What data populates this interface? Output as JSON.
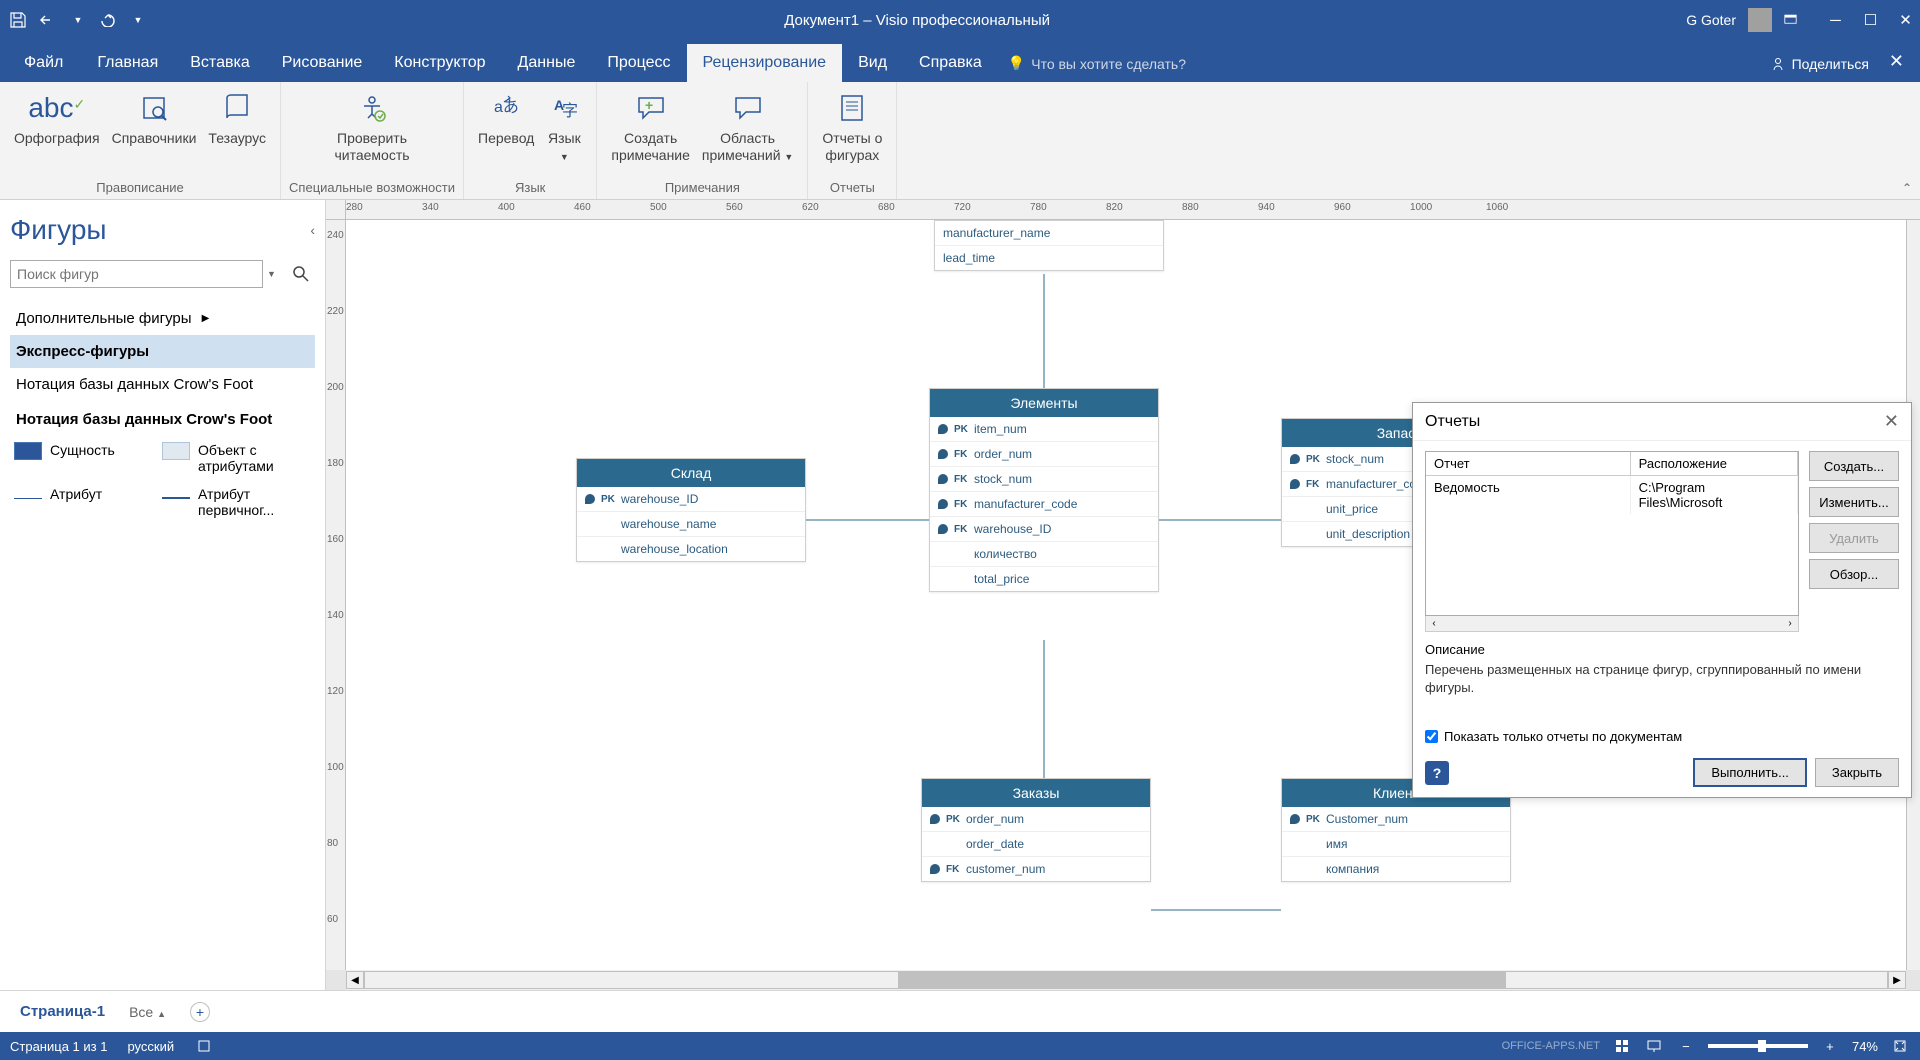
{
  "titlebar": {
    "title": "Документ1  –  Visio профессиональный",
    "user": "G Goter"
  },
  "tabs": {
    "file": "Файл",
    "items": [
      "Главная",
      "Вставка",
      "Рисование",
      "Конструктор",
      "Данные",
      "Процесс",
      "Рецензирование",
      "Вид",
      "Справка"
    ],
    "active_index": 6,
    "tellme": "Что вы хотите сделать?",
    "share": "Поделиться"
  },
  "ribbon": {
    "groups": [
      {
        "title": "Правописание",
        "buttons": [
          {
            "label": "Орфография"
          },
          {
            "label": "Справочники"
          },
          {
            "label": "Тезаурус"
          }
        ]
      },
      {
        "title": "Специальные возможности",
        "buttons": [
          {
            "label": "Проверить\nчитаемость"
          }
        ]
      },
      {
        "title": "Язык",
        "buttons": [
          {
            "label": "Перевод"
          },
          {
            "label": "Язык"
          }
        ]
      },
      {
        "title": "Примечания",
        "buttons": [
          {
            "label": "Создать\nпримечание"
          },
          {
            "label": "Область\nпримечаний"
          }
        ]
      },
      {
        "title": "Отчеты",
        "buttons": [
          {
            "label": "Отчеты о\nфигурах"
          }
        ]
      }
    ]
  },
  "shapes": {
    "title": "Фигуры",
    "search_placeholder": "Поиск фигур",
    "more": "Дополнительные фигуры",
    "items": [
      "Экспресс-фигуры",
      "Нотация базы данных Crow's Foot"
    ],
    "active_item": 0,
    "section_title": "Нотация базы данных Crow's Foot",
    "stencil": [
      {
        "name": "Сущность"
      },
      {
        "name": "Объект с атрибутами"
      },
      {
        "name": "Атрибут"
      },
      {
        "name": "Атрибут первичног..."
      }
    ]
  },
  "ruler_h": [
    280,
    340,
    400,
    460,
    500,
    560,
    620,
    680,
    720,
    780,
    820,
    880,
    940,
    960,
    1000,
    1060
  ],
  "ruler_v": [
    240,
    220,
    200,
    180,
    160,
    140,
    120,
    100,
    80,
    60
  ],
  "entities": {
    "partial_top": {
      "rows": [
        "manufacturer_name",
        "lead_time"
      ]
    },
    "warehouse": {
      "title": "Склад",
      "rows": [
        {
          "key": "PK",
          "name": "warehouse_ID"
        },
        {
          "key": "",
          "name": "warehouse_name"
        },
        {
          "key": "",
          "name": "warehouse_location"
        }
      ]
    },
    "elements": {
      "title": "Элементы",
      "rows": [
        {
          "key": "PK",
          "name": "item_num"
        },
        {
          "key": "FK",
          "name": "order_num"
        },
        {
          "key": "FK",
          "name": "stock_num"
        },
        {
          "key": "FK",
          "name": "manufacturer_code"
        },
        {
          "key": "FK",
          "name": "warehouse_ID"
        },
        {
          "key": "",
          "name": "количество"
        },
        {
          "key": "",
          "name": "total_price"
        }
      ]
    },
    "stock": {
      "title": "Запас",
      "rows": [
        {
          "key": "PK",
          "name": "stock_num"
        },
        {
          "key": "FK",
          "name": "manufacturer_code"
        },
        {
          "key": "",
          "name": "unit_price"
        },
        {
          "key": "",
          "name": "unit_description"
        }
      ]
    },
    "orders": {
      "title": "Заказы",
      "rows": [
        {
          "key": "PK",
          "name": "order_num"
        },
        {
          "key": "",
          "name": "order_date"
        },
        {
          "key": "FK",
          "name": "customer_num"
        }
      ]
    },
    "client": {
      "title": "Клиент",
      "rows": [
        {
          "key": "PK",
          "name": "Customer_num"
        },
        {
          "key": "",
          "name": "имя"
        },
        {
          "key": "",
          "name": "компания"
        }
      ]
    }
  },
  "reports": {
    "title": "Отчеты",
    "col1": "Отчет",
    "col2": "Расположение",
    "row1_name": "Ведомость",
    "row1_path": "C:\\Program Files\\Microsoft",
    "btn_create": "Создать...",
    "btn_edit": "Изменить...",
    "btn_delete": "Удалить",
    "btn_browse": "Обзор...",
    "desc_label": "Описание",
    "desc": "Перечень размещенных на странице фигур, сгруппированный по имени фигуры.",
    "check": "Показать только отчеты по документам",
    "btn_run": "Выполнить...",
    "btn_close": "Закрыть"
  },
  "pagetabs": {
    "page": "Страница-1",
    "all": "Все"
  },
  "status": {
    "page": "Страница 1 из 1",
    "lang": "русский",
    "zoom": "74%"
  },
  "watermark": "OFFICE-APPS.NET"
}
